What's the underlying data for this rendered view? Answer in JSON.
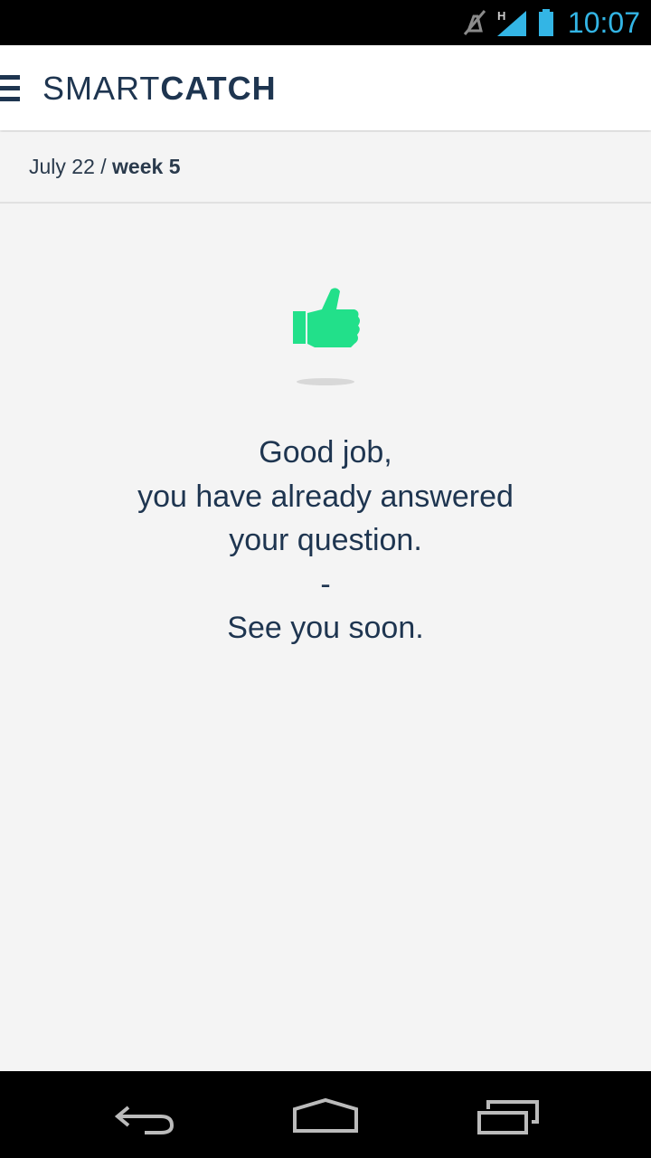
{
  "status_bar": {
    "time": "10:07",
    "icons": [
      "mute-icon",
      "signal-h-icon",
      "battery-icon"
    ],
    "accent_color": "#33b5e5"
  },
  "app_bar": {
    "logo_light": "SMART",
    "logo_bold": "CATCH",
    "menu_icon": "hamburger-menu-icon"
  },
  "date_bar": {
    "date": "July 22",
    "separator": " / ",
    "week": "week 5"
  },
  "message": {
    "icon": "thumbs-up-icon",
    "icon_color": "#22e08a",
    "lines": [
      "Good job,",
      "you have already answered",
      "your question.",
      "-",
      "See you soon."
    ]
  },
  "nav_bar": {
    "buttons": [
      "back-icon",
      "home-icon",
      "recent-apps-icon"
    ]
  },
  "colors": {
    "text_primary": "#1e3550",
    "background": "#f4f4f4"
  }
}
